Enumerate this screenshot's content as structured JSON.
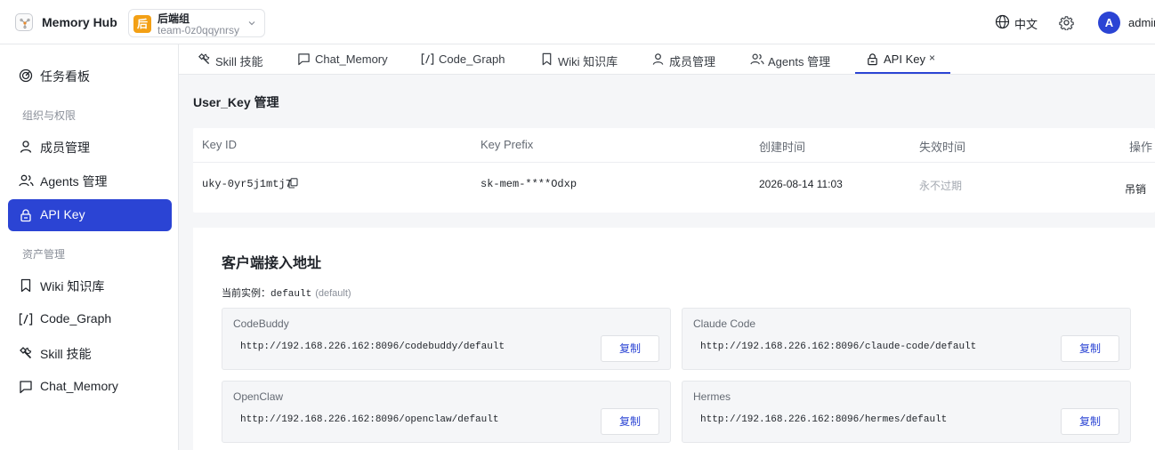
{
  "header": {
    "brand_title": "Memory Hub",
    "team": {
      "badge": "后",
      "name": "后端组",
      "id": "team-0z0qqynrsy"
    },
    "language": "中文",
    "avatar_letter": "A",
    "user_name": "admin",
    "accent_color": "#2b44d4"
  },
  "sidebar": {
    "top_item": {
      "label": "任务看板",
      "icon": "dashboard-icon"
    },
    "group_org": "组织与权限",
    "org_items": [
      {
        "label": "成员管理",
        "icon": "user-icon"
      },
      {
        "label": "Agents 管理",
        "icon": "users-icon"
      },
      {
        "label": "API Key",
        "icon": "lock-icon",
        "active": true
      }
    ],
    "group_assets": "资产管理",
    "asset_items": [
      {
        "label": "Wiki 知识库",
        "icon": "bookmark-icon"
      },
      {
        "label": "Code_Graph",
        "icon": "code-brackets-icon"
      },
      {
        "label": "Skill 技能",
        "icon": "tools-icon"
      },
      {
        "label": "Chat_Memory",
        "icon": "chat-icon"
      }
    ]
  },
  "tabs": [
    {
      "label": "Skill 技能",
      "icon": "tools-icon"
    },
    {
      "label": "Chat_Memory",
      "icon": "chat-icon"
    },
    {
      "label": "Code_Graph",
      "icon": "code-brackets-icon"
    },
    {
      "label": "Wiki 知识库",
      "icon": "bookmark-icon"
    },
    {
      "label": "成员管理",
      "icon": "user-icon"
    },
    {
      "label": "Agents 管理",
      "icon": "users-icon"
    },
    {
      "label": "API Key",
      "icon": "lock-icon",
      "active": true,
      "close": "×"
    }
  ],
  "key_section": {
    "title": "User_Key 管理",
    "columns": [
      "Key ID",
      "Key Prefix",
      "创建时间",
      "失效时间",
      "操作"
    ],
    "rows": [
      {
        "key_id": "uky-0yr5j1mtj7",
        "prefix": "sk-mem-****Odxp",
        "created": "2026-08-14 11:03",
        "expires": "永不过期",
        "action": "吊销"
      }
    ]
  },
  "client_section": {
    "title": "客户端接入地址",
    "instance_label": "当前实例：",
    "instance_value": "default",
    "instance_hint": "(default)",
    "endpoints": [
      {
        "name": "CodeBuddy",
        "url": "http://192.168.226.162:8096/codebuddy/default",
        "button": "复制"
      },
      {
        "name": "Claude Code",
        "url": "http://192.168.226.162:8096/claude-code/default",
        "button": "复制"
      },
      {
        "name": "OpenClaw",
        "url": "http://192.168.226.162:8096/openclaw/default",
        "button": "复制"
      },
      {
        "name": "Hermes",
        "url": "http://192.168.226.162:8096/hermes/default",
        "button": "复制"
      }
    ]
  }
}
